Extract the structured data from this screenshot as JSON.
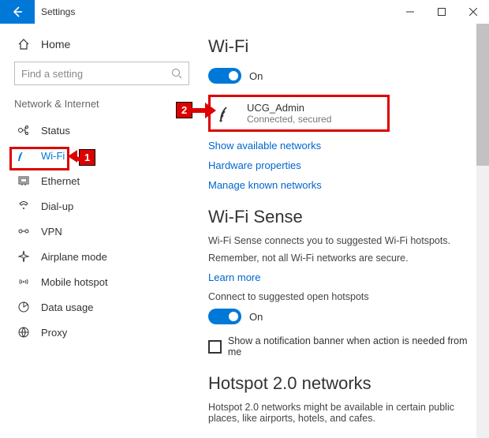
{
  "titlebar": {
    "title": "Settings"
  },
  "home_label": "Home",
  "search": {
    "placeholder": "Find a setting"
  },
  "category": "Network & Internet",
  "nav": {
    "status": "Status",
    "wifi": "Wi-Fi",
    "ethernet": "Ethernet",
    "dialup": "Dial-up",
    "vpn": "VPN",
    "airplane": "Airplane mode",
    "hotspot": "Mobile hotspot",
    "data": "Data usage",
    "proxy": "Proxy"
  },
  "main": {
    "wifi_title": "Wi-Fi",
    "on_label": "On",
    "network": {
      "name": "UCG_Admin",
      "status": "Connected, secured"
    },
    "show_networks": "Show available networks",
    "hw_props": "Hardware properties",
    "manage_known": "Manage known networks",
    "sense_title": "Wi-Fi Sense",
    "sense_p1": "Wi-Fi Sense connects you to suggested Wi-Fi hotspots.",
    "sense_p2": "Remember, not all Wi-Fi networks are secure.",
    "learn_more": "Learn more",
    "open_hs": "Connect to suggested open hotspots",
    "on_label2": "On",
    "notif": "Show a notification banner when action is needed from me",
    "h20_title": "Hotspot 2.0 networks",
    "h20_p": "Hotspot 2.0 networks might be available in certain public places, like airports, hotels, and cafes."
  },
  "annotations": {
    "a1": "1",
    "a2": "2"
  }
}
